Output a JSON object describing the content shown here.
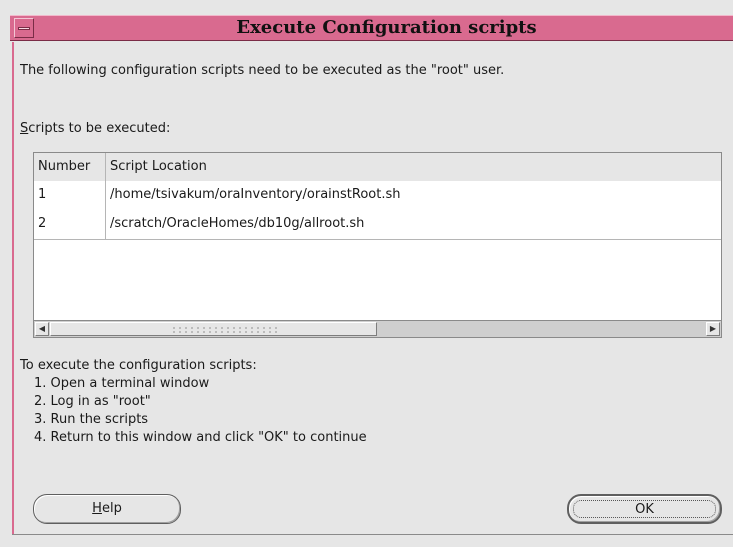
{
  "window": {
    "title": "Execute Configuration scripts"
  },
  "intro_text": "The following configuration scripts need to be executed as the \"root\" user.",
  "scripts_label_mnemonic": "S",
  "scripts_label_rest": "cripts to be executed:",
  "table": {
    "columns": [
      "Number",
      "Script Location"
    ],
    "rows": [
      {
        "number": "1",
        "location": "/home/tsivakum/oraInventory/orainstRoot.sh"
      },
      {
        "number": "2",
        "location": "/scratch/OracleHomes/db10g/allroot.sh"
      }
    ]
  },
  "scrollbar": {
    "left_arrow": "◀",
    "right_arrow": "▶"
  },
  "instructions": {
    "heading": "To execute the configuration scripts:",
    "steps": [
      "1. Open a terminal window",
      "2. Log in as \"root\"",
      "3. Run the scripts",
      "4. Return to this window and click \"OK\" to continue"
    ]
  },
  "buttons": {
    "help_mnemonic": "H",
    "help_rest": "elp",
    "ok": "OK"
  }
}
